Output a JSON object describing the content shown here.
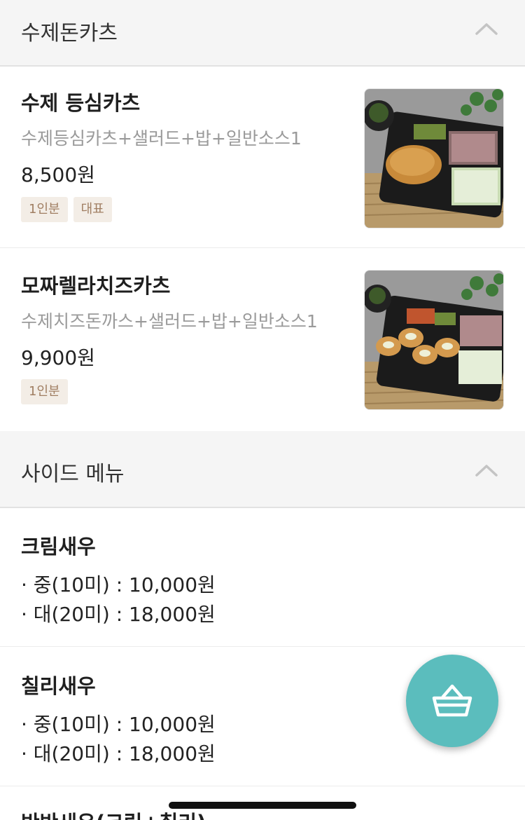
{
  "sections": {
    "main": {
      "title": "수제돈카츠"
    },
    "side": {
      "title": "사이드 메뉴"
    }
  },
  "menu_items": [
    {
      "name": "수제 등심카츠",
      "description": "수제등심카츠+샐러드+밥+일반소스1",
      "price": "8,500원",
      "tags": [
        "1인분",
        "대표"
      ],
      "thumbnail_icon": "tonkatsu-bento-photo"
    },
    {
      "name": "모짜렐라치즈카츠",
      "description": "수제치즈돈까스+샐러드+밥+일반소스1",
      "price": "9,900원",
      "tags": [
        "1인분"
      ],
      "thumbnail_icon": "cheese-katsu-bento-photo"
    }
  ],
  "side_items": [
    {
      "name": "크림새우",
      "lines": [
        "· 중(10미) : 10,000원",
        "· 대(20미) : 18,000원"
      ]
    },
    {
      "name": "칠리새우",
      "lines": [
        "· 중(10미) : 10,000원",
        "· 대(20미) : 18,000원"
      ]
    },
    {
      "name": "반반새우(크림+칠리)"
    }
  ],
  "colors": {
    "accent_teal": "#5bbdbd",
    "tag_bg": "#f3ede6",
    "tag_text": "#a07e62",
    "header_bg": "#f5f5f5"
  },
  "icons": {
    "collapse": "chevron-up-icon",
    "cart": "basket-icon"
  }
}
